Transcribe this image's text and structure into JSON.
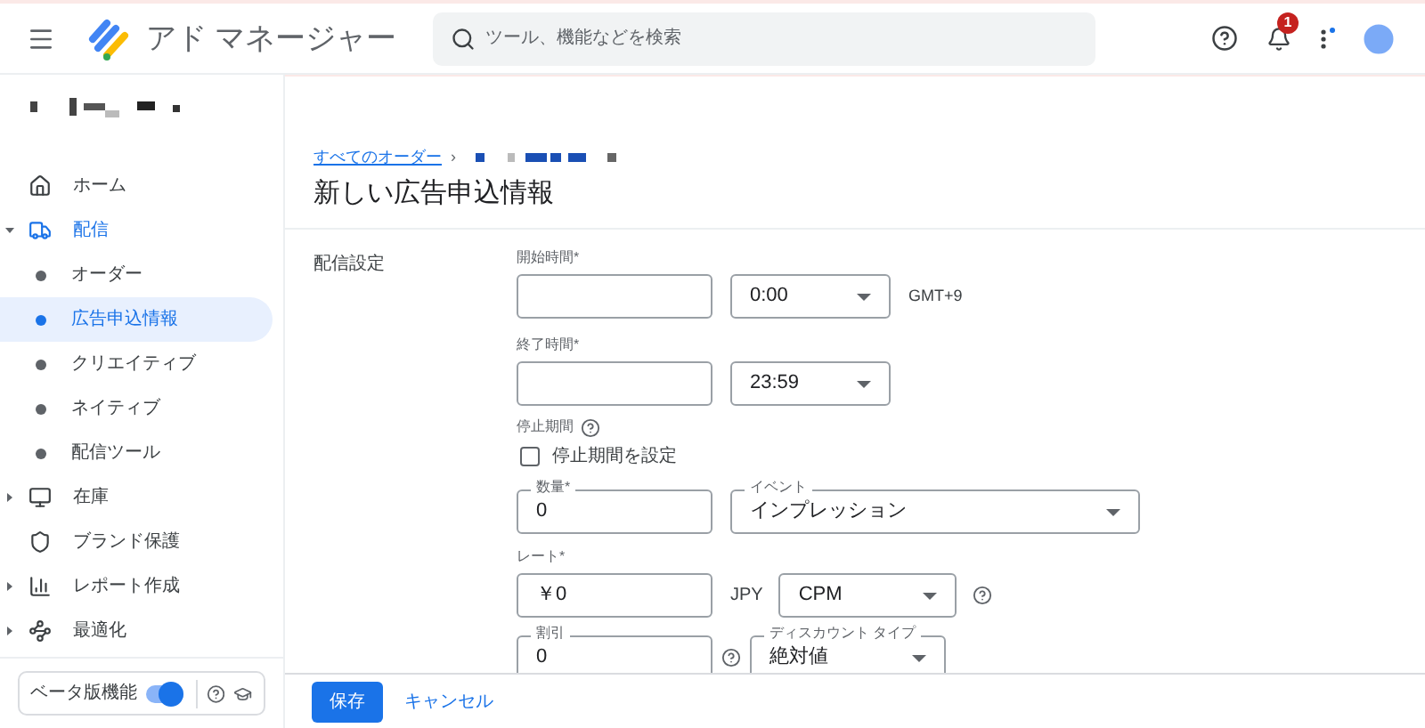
{
  "header": {
    "app_name": "アド マネージャー",
    "search": {
      "placeholder": "ツール、機能などを検索"
    },
    "notification_count": "1"
  },
  "sidebar": {
    "items": [
      {
        "kind": "link",
        "label": "ホーム",
        "selected": false
      },
      {
        "kind": "group",
        "label": "配信",
        "selected": true,
        "expanded": true,
        "children": [
          {
            "label": "オーダー",
            "selected": false
          },
          {
            "label": "広告申込情報",
            "selected": true
          },
          {
            "label": "クリエイティブ",
            "selected": false
          },
          {
            "label": "ネイティブ",
            "selected": false
          },
          {
            "label": "配信ツール",
            "selected": false
          }
        ]
      },
      {
        "kind": "group",
        "label": "在庫",
        "selected": false,
        "expanded": false
      },
      {
        "kind": "link",
        "label": "ブランド保護",
        "selected": false
      },
      {
        "kind": "group",
        "label": "レポート作成",
        "selected": false,
        "expanded": false
      },
      {
        "kind": "group",
        "label": "最適化",
        "selected": false,
        "expanded": false
      }
    ],
    "beta": {
      "label": "ベータ版機能",
      "on": true
    }
  },
  "breadcrumb": {
    "link": "すべてのオーダー",
    "separator": "›"
  },
  "page_title": "新しい広告申込情報",
  "section": {
    "title": "配信設定",
    "start": {
      "label": "開始時間*",
      "time": "0:00",
      "timezone": "GMT+9"
    },
    "end": {
      "label": "終了時間*",
      "time": "23:59"
    },
    "pause": {
      "label": "停止期間",
      "checkbox": "停止期間を設定",
      "checked": false
    },
    "quantity": {
      "label": "数量*",
      "value": "0"
    },
    "event": {
      "label": "イベント",
      "value": "インプレッション"
    },
    "rate": {
      "label": "レート*",
      "value": "￥0",
      "currency": "JPY",
      "type": "CPM"
    },
    "discount": {
      "label": "割引",
      "value": "0",
      "type_label": "ディスカウント タイプ",
      "type": "絶対値"
    }
  },
  "footer": {
    "buttons": [
      "保存",
      "キャンセル"
    ]
  }
}
